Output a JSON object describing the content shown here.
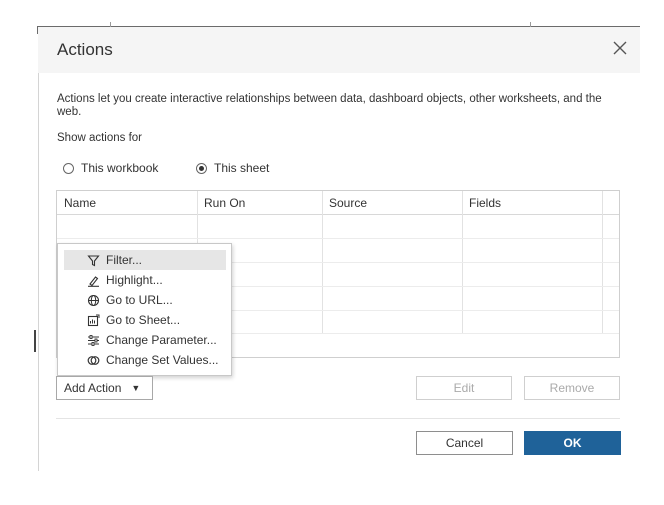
{
  "dialog": {
    "title": "Actions",
    "close_icon": "close-icon",
    "description": "Actions let you create interactive relationships between data, dashboard objects, other worksheets, and the web.",
    "show_actions_for_label": "Show actions for",
    "scope_options": [
      {
        "label": "This workbook",
        "selected": false
      },
      {
        "label": "This sheet",
        "selected": true
      }
    ]
  },
  "table": {
    "columns": [
      "Name",
      "Run On",
      "Source",
      "Fields"
    ],
    "rows": []
  },
  "menu": {
    "items": [
      {
        "label": "Filter...",
        "icon": "filter-icon",
        "highlighted": true
      },
      {
        "label": "Highlight...",
        "icon": "highlight-icon",
        "highlighted": false
      },
      {
        "label": "Go to URL...",
        "icon": "globe-icon",
        "highlighted": false
      },
      {
        "label": "Go to Sheet...",
        "icon": "go-to-sheet-icon",
        "highlighted": false
      },
      {
        "label": "Change Parameter...",
        "icon": "parameter-icon",
        "highlighted": false
      },
      {
        "label": "Change Set Values...",
        "icon": "set-values-icon",
        "highlighted": false
      }
    ]
  },
  "buttons": {
    "add_action": "Add Action",
    "edit": "Edit",
    "remove": "Remove",
    "cancel": "Cancel",
    "ok": "OK"
  },
  "colors": {
    "ok_button": "#1f6299",
    "title_bar": "#f5f5f5",
    "menu_highlight": "#e6e6e6"
  }
}
